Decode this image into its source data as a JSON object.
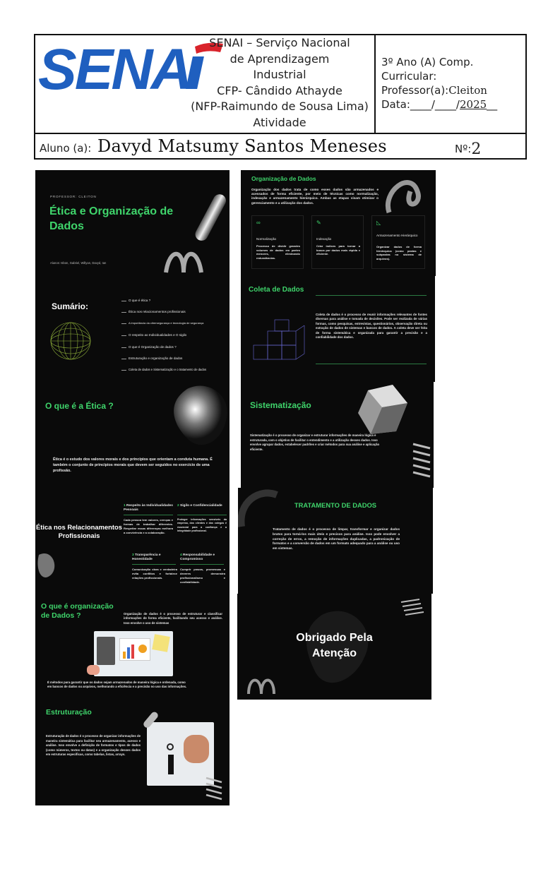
{
  "header": {
    "logo_text": "SENAi",
    "school_lines": [
      "SENAI – Serviço Nacional",
      "de Aprendizagem",
      "Industrial",
      "CFP- Cândido Athayde",
      "(NFP-Raimundo de Sousa Lima)",
      "Atividade"
    ],
    "class_line": "3º Ano (A) Comp.",
    "curricular_label": "Curricular:",
    "professor_label": "Professor(a):",
    "professor_value": "Cleiton",
    "date_label": "Data:____/____/",
    "date_year": "2025",
    "date_tail": "__",
    "student_label": "Aluno (a):",
    "student_name": "Davyd Matsumy Santos Meneses",
    "number_label": "Nº:",
    "number_value": "2"
  },
  "colors": {
    "accent_green": "#3fd46b",
    "slide_bg": "#0a0a0a",
    "logo_blue": "#1f5fbf"
  },
  "slides": {
    "s1": {
      "kicker": "PROFESSOR: CLEITON",
      "title_line1": "Ética e Organização de",
      "title_line2": "Dados",
      "authors": "Alunos: Isbon, Gabriel, Willyan, Davyd, Ian"
    },
    "s2": {
      "title": "Organização de Dados",
      "intro": "Organização dos dados trata de como esses dados são armazenados e acessados de forma eficiente, por meio de técnicas como normalização, indexação e armazenamento hierárquico. Ambas as etapas visam otimizar o gerenciamento e a utilização dos dados.",
      "cards": [
        {
          "icon": "glasses-icon",
          "title": "Normalização",
          "text": "Processo de dividir grandes volumes de dados em partes menores, eliminando redundâncias."
        },
        {
          "icon": "pencil-icon",
          "title": "Indexação",
          "text": "Criar índices para tornar a busca por dados mais rápida e eficiente."
        },
        {
          "icon": "ruler-icon",
          "title": "Armazenamento Hierárquico",
          "text": "Organizar dados de forma hierárquica (como pastas e subpastas no sistema de arquivos)."
        }
      ]
    },
    "s3": {
      "title": "Sumário:",
      "items": [
        "O que é ética ?",
        "Ética nos relacionamentos profissionais",
        "A importância da cibersegurança e tecnologia de segurança",
        "O respeito ao Individualidades e O sigilo",
        "O que é Organização de dados ?",
        "Estruturação e organização de dados",
        "Coleta de dados e Sistematização e o tratamento de dados"
      ]
    },
    "s4": {
      "title": "Coleta de Dados",
      "text": "Coleta de dados é o processo de reunir informações relevantes de fontes diversas para análise e tomada de decisões. Pode ser realizada de várias formas, como pesquisas, entrevistas, questionários, observação direta ou extração de dados de sistemas e bancos de dados. A coleta deve ser feita de forma sistemática e organizada para garantir a precisão e a confiabilidade dos dados."
    },
    "s5": {
      "title": "O que é a Ética ?",
      "text": "Ética é o estudo dos valores morais e dos princípios que orientam a conduta humana. É também o conjunto de princípios morais que devem ser seguidos no exercício de uma profissão."
    },
    "s6": {
      "title": "Sistematização",
      "text": "Sistematização é o processo de organizar e estruturar informações de maneira lógica e estruturada, com o objetivo de facilitar o entendimento e a utilização desses dados. Isso envolve agrupar dados, estabelecer padrões e criar métodos para sua análise e aplicação eficiente."
    },
    "s7": {
      "title_line1": "Ética nos Relacionamentos",
      "title_line2": "Profissionais",
      "blocks": [
        {
          "num": "1",
          "title": "Respeito às Individualidades Pessoais",
          "text": "Cada pessoa tem valores, crenças e formas de trabalhar diferentes. Respeitar essas diferenças melhora a convivência e a colaboração."
        },
        {
          "num": "2",
          "title": "Sigilo e Confidencialidade",
          "text": "Proteger informações sensíveis da empresa, dos clientes e dos colegas é essencial para a confiança e a integridade profissional."
        },
        {
          "num": "3",
          "title": "Transparência e Honestidade",
          "text": "Comunicação clara e verdadeira evita conflitos e fortalece relações profissionais."
        },
        {
          "num": "4",
          "title": "Responsabilidade e Compromisso",
          "text": "Cumprir prazos, promessas e deveres demonstra profissionalismo e confiabilidade."
        }
      ]
    },
    "s8": {
      "title": "TRATAMENTO DE DADOS",
      "text": "Tratamento de dados é o processo de limpar, transformar e organizar dados brutos para torná-los mais úteis e precisos para análise. Isso pode envolver a correção de erros, a remoção de informações duplicadas, a padronização de formatos e a conversão de dados em um formato adequado para a análise ou uso em sistemas."
    },
    "s9": {
      "title_line1": "O que é organização",
      "title_line2": "de Dados ?",
      "text_top": "Organização de dados é o processo de estruturar e classificar informações de forma eficiente, facilitando seu acesso e análise. Isso envolve o uso de sistemas",
      "text_bottom": "É métodos para garantir que os dados sejam armazenados de maneira lógica e ordenada, como em bancos de dados ou arquivos, melhorando a eficiência e a precisão no uso das informações.",
      "subtitle": "Estruturação",
      "text_struct": "Estruturação de dados é o processo de organizar informações de maneira sistemática para facilitar seu armazenamento, acesso e análise. Isso envolve a definição de formatos e tipos de dados (como números, textos ou datas) e a organização desses dados em estruturas específicas, como tabelas, listas, arrays."
    },
    "s10": {
      "title_line1": "Obrigado Pela",
      "title_line2": "Atenção"
    }
  }
}
